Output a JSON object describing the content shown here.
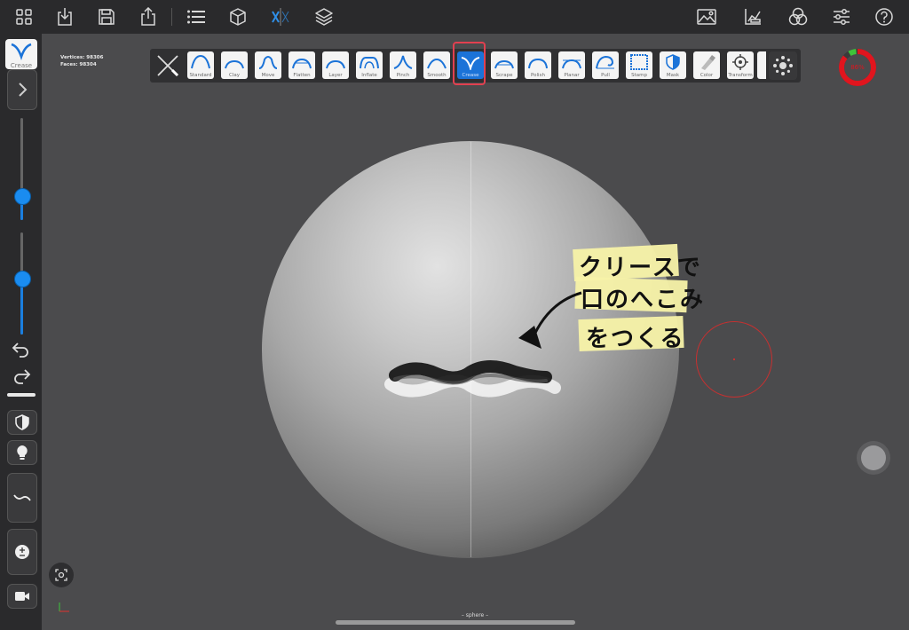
{
  "top_toolbar": {
    "icons": [
      "grid-icon",
      "import-icon",
      "save-icon",
      "share-icon",
      "list-icon",
      "cube-icon",
      "symmetry-icon",
      "layers-icon",
      "background-icon",
      "measure-icon",
      "color-channels-icon",
      "settings-sliders-icon",
      "help-icon"
    ]
  },
  "stats": {
    "vertices_label": "Vertices: 98306",
    "faces_label": "Faces:    98304"
  },
  "active_tool": {
    "label": "Crease"
  },
  "tools": [
    {
      "label": "Standard"
    },
    {
      "label": "Clay"
    },
    {
      "label": "Move"
    },
    {
      "label": "Flatten"
    },
    {
      "label": "Layer"
    },
    {
      "label": "Inflate"
    },
    {
      "label": "Pinch"
    },
    {
      "label": "Smooth"
    },
    {
      "label": "Crease"
    },
    {
      "label": "Scrape"
    },
    {
      "label": "Polish"
    },
    {
      "label": "Planar"
    },
    {
      "label": "Pull"
    },
    {
      "label": "Stamp"
    },
    {
      "label": "Mask"
    },
    {
      "label": "Color"
    },
    {
      "label": "Transform"
    }
  ],
  "memory_gauge": {
    "value_label": "86%",
    "fraction": 0.86
  },
  "annotation": {
    "lines": [
      "クリースで",
      "口のへこみ",
      "をつくる"
    ]
  },
  "mesh_name": "– sphere –",
  "colors": {
    "accent": "#1b73d8",
    "highlight": "#e24050",
    "note": "#f7f2a8",
    "gauge_red": "#e0151e",
    "gauge_green": "#3ec43a"
  }
}
